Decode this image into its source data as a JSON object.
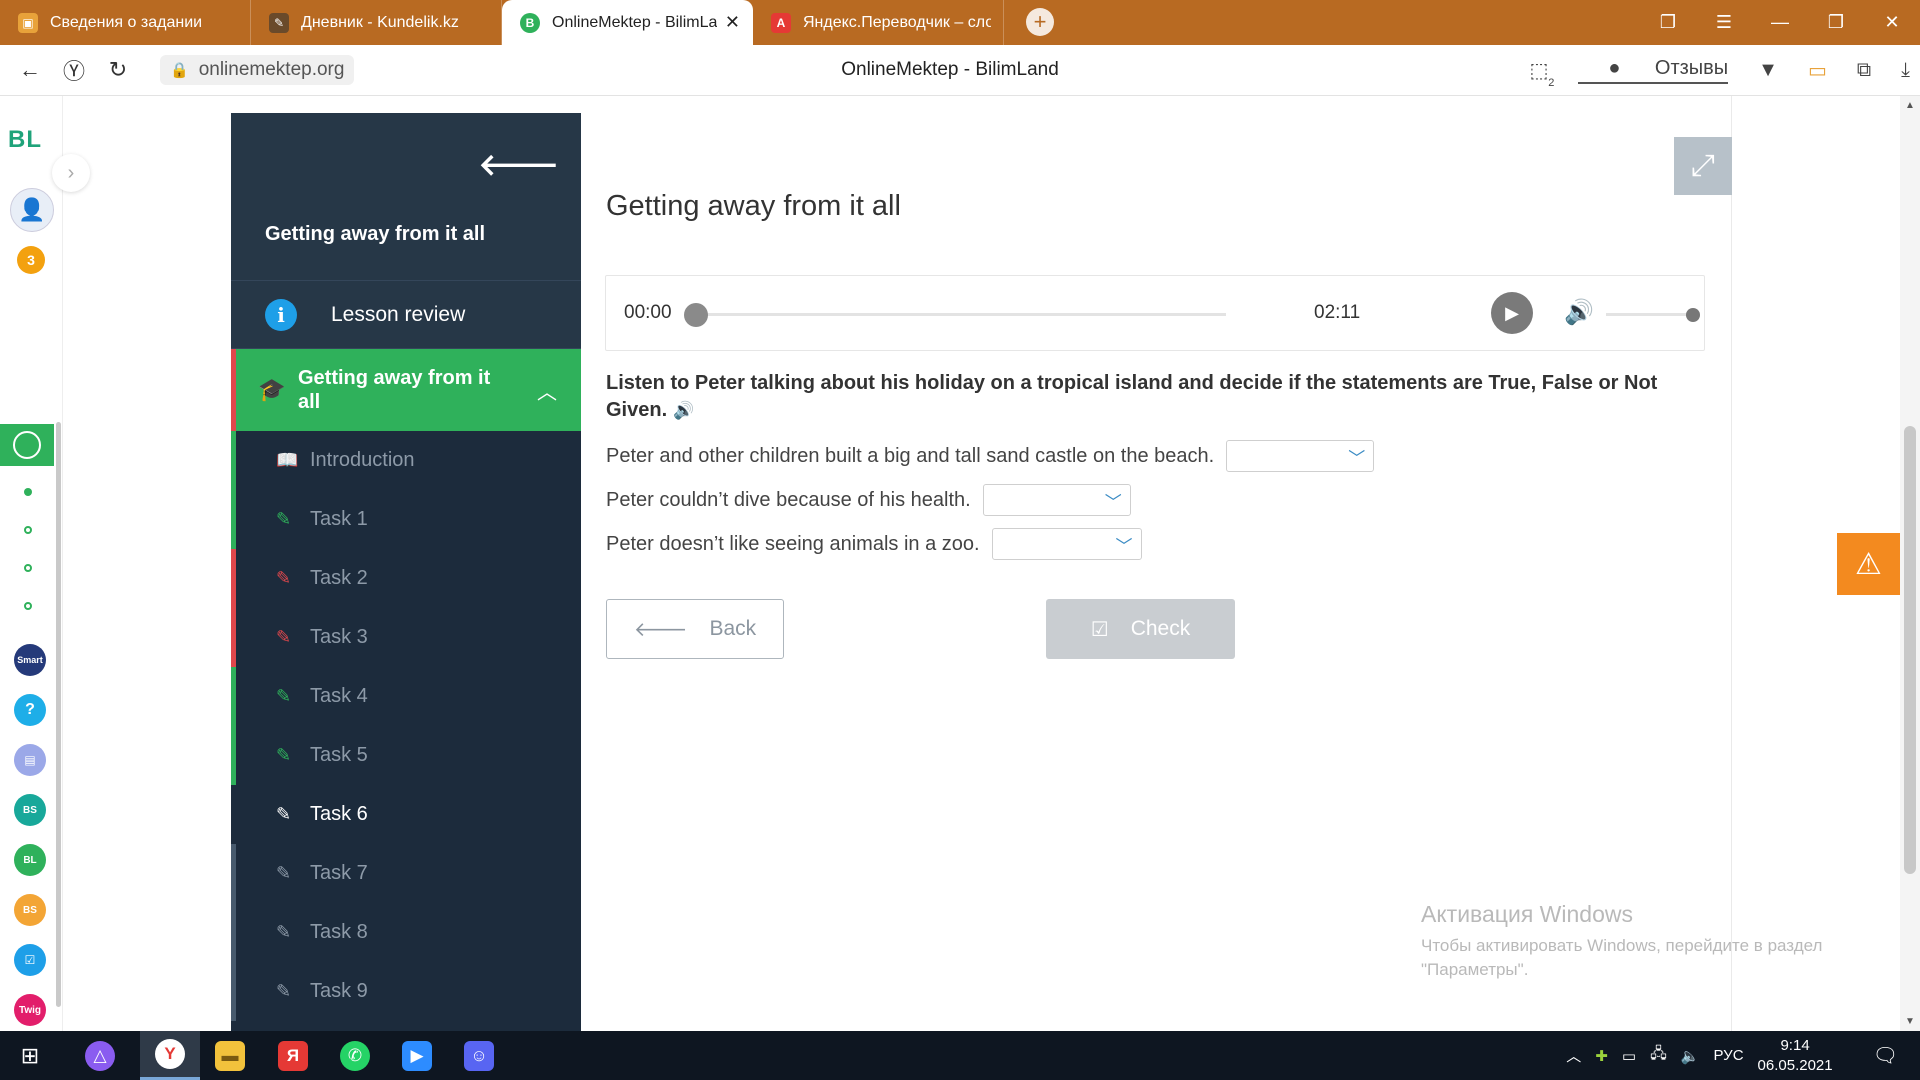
{
  "browser": {
    "tabs": [
      {
        "title": "Сведения о задании",
        "active": false,
        "color": "#e8a23a"
      },
      {
        "title": "Дневник - Kundelik.kz",
        "active": false,
        "color": "#6a4a2a"
      },
      {
        "title": "OnlineMektep - BilimLand",
        "active": true,
        "color": "#2fb15b"
      },
      {
        "title": "Яндекс.Переводчик – сло",
        "active": false,
        "color": "#e53935"
      }
    ],
    "url": "onlinemektep.org",
    "page_title": "OnlineMektep - BilimLand",
    "reviews_label": "Отзывы",
    "downloads_count": "2"
  },
  "rail": {
    "logo": "BL",
    "points_badge": "3",
    "apps": [
      {
        "label": "Smart",
        "color": "#253a7a"
      },
      {
        "label": "?",
        "color": "#1eaee8"
      },
      {
        "label": "▤",
        "color": "#9ba8e8"
      },
      {
        "label": "BS",
        "color": "#18a89a"
      },
      {
        "label": "BL",
        "color": "#2fb15b"
      },
      {
        "label": "BS",
        "color": "#f3a535"
      },
      {
        "label": "☑",
        "color": "#1e9fe8"
      },
      {
        "label": "Twig",
        "color": "#e21e6b"
      }
    ]
  },
  "course": {
    "title": "Getting away from it all",
    "lesson_review": "Lesson review",
    "section_title": "Getting away from it all",
    "items": [
      {
        "label": "Introduction",
        "icon": "book-icon",
        "state": "ok"
      },
      {
        "label": "Task 1",
        "icon": "edit-icon",
        "state": "ok"
      },
      {
        "label": "Task 2",
        "icon": "edit-icon",
        "state": "bad"
      },
      {
        "label": "Task 3",
        "icon": "edit-icon",
        "state": "bad"
      },
      {
        "label": "Task 4",
        "icon": "edit-icon",
        "state": "ok"
      },
      {
        "label": "Task 5",
        "icon": "edit-icon",
        "state": "ok"
      },
      {
        "label": "Task 6",
        "icon": "edit-icon",
        "state": "current"
      },
      {
        "label": "Task 7",
        "icon": "edit-icon",
        "state": "none"
      },
      {
        "label": "Task 8",
        "icon": "edit-icon",
        "state": "none"
      },
      {
        "label": "Task 9",
        "icon": "edit-icon",
        "state": "none"
      }
    ]
  },
  "main": {
    "title": "Getting away from it all",
    "player": {
      "current": "00:00",
      "duration": "02:11",
      "progress": 0,
      "volume": 1.0
    },
    "instruction": "Listen to Peter talking about his holiday on a tropical island and decide if the statements are True, False or Not Given.",
    "questions": [
      {
        "text": "Peter and other children built a big and tall sand castle on the beach.",
        "selected": ""
      },
      {
        "text": "Peter couldn’t dive because of his health.",
        "selected": ""
      },
      {
        "text": "Peter doesn’t like seeing animals in a zoo.",
        "selected": ""
      }
    ],
    "back_label": "Back",
    "check_label": "Check"
  },
  "watermark": {
    "line1": "Активация Windows",
    "line2": "Чтобы активировать Windows, перейдите в раздел",
    "line3": "\"Параметры\"."
  },
  "taskbar": {
    "time": "9:14",
    "date": "06.05.2021",
    "lang": "РУС"
  },
  "colors": {
    "accent_green": "#2fb15b",
    "sidebar_dark": "#1c2b3c",
    "error_red": "#e0474c",
    "warning_orange": "#f38a1f"
  }
}
